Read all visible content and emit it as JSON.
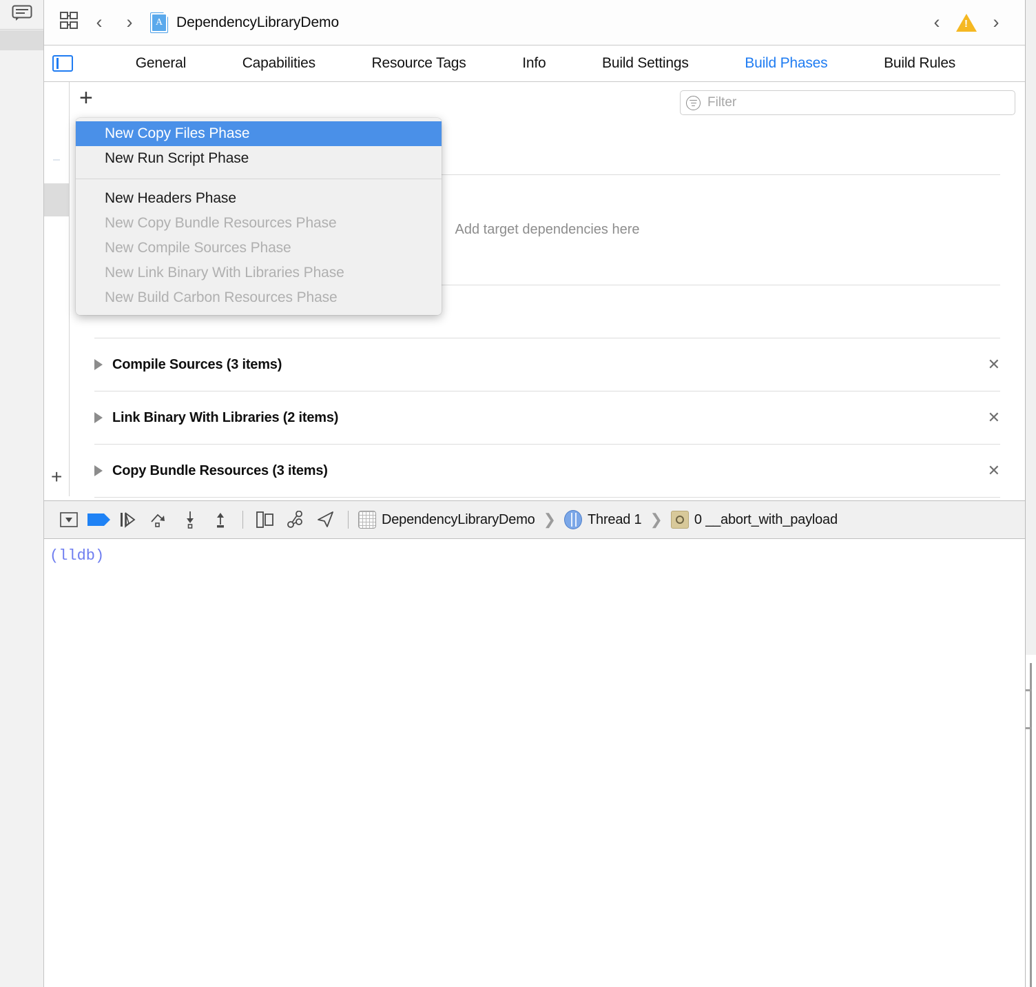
{
  "window": {
    "title": "DependencyLibraryDemo",
    "accent_blue": "#1f7cf2",
    "selection_blue": "#4a90e8",
    "warning_yellow": "#f5b822"
  },
  "toolbar": {
    "icons": {
      "comments": "comments-icon",
      "grid": "grid-icon",
      "back": "‹",
      "forward": "›",
      "issue_prev": "‹",
      "issue_next": "›",
      "warning": "warning-triangle-icon"
    },
    "document_title": "DependencyLibraryDemo",
    "doc_icon_glyph": "A"
  },
  "tabs": [
    {
      "label": "General",
      "active": false
    },
    {
      "label": "Capabilities",
      "active": false
    },
    {
      "label": "Resource Tags",
      "active": false
    },
    {
      "label": "Info",
      "active": false
    },
    {
      "label": "Build Settings",
      "active": false
    },
    {
      "label": "Build Phases",
      "active": true
    },
    {
      "label": "Build Rules",
      "active": false
    }
  ],
  "pane": {
    "add_button_label": "+",
    "filter": {
      "placeholder": "Filter",
      "value": ""
    },
    "dependencies_placeholder": "Add target dependencies here",
    "phases": [
      {
        "label": "Compile Sources (3 items)",
        "close": "✕"
      },
      {
        "label": "Link Binary With Libraries (2 items)",
        "close": "✕"
      },
      {
        "label": "Copy Bundle Resources (3 items)",
        "close": "✕"
      }
    ]
  },
  "menu": {
    "items": [
      {
        "label": "New Copy Files Phase",
        "state": "selected"
      },
      {
        "label": "New Run Script Phase",
        "state": "enabled"
      },
      {
        "label": "New Headers Phase",
        "state": "enabled"
      },
      {
        "label": "New Copy Bundle Resources Phase",
        "state": "disabled"
      },
      {
        "label": "New Compile Sources Phase",
        "state": "disabled"
      },
      {
        "label": "New Link Binary With Libraries Phase",
        "state": "disabled"
      },
      {
        "label": "New Build Carbon Resources Phase",
        "state": "disabled"
      }
    ]
  },
  "debug_bar": {
    "icons": [
      "hide-debug-area-icon",
      "breakpoints-toggle-icon",
      "continue-icon",
      "step-over-icon",
      "step-into-icon",
      "step-out-icon",
      "view-debugging-icon",
      "memory-graph-icon",
      "simulate-location-icon"
    ],
    "breadcrumb": {
      "process": "DependencyLibraryDemo",
      "thread": "Thread 1",
      "frame": "0 __abort_with_payload",
      "separator": "❯"
    }
  },
  "console": {
    "prompt": "(lldb)"
  },
  "gutter": {
    "add_button_label": "+"
  }
}
